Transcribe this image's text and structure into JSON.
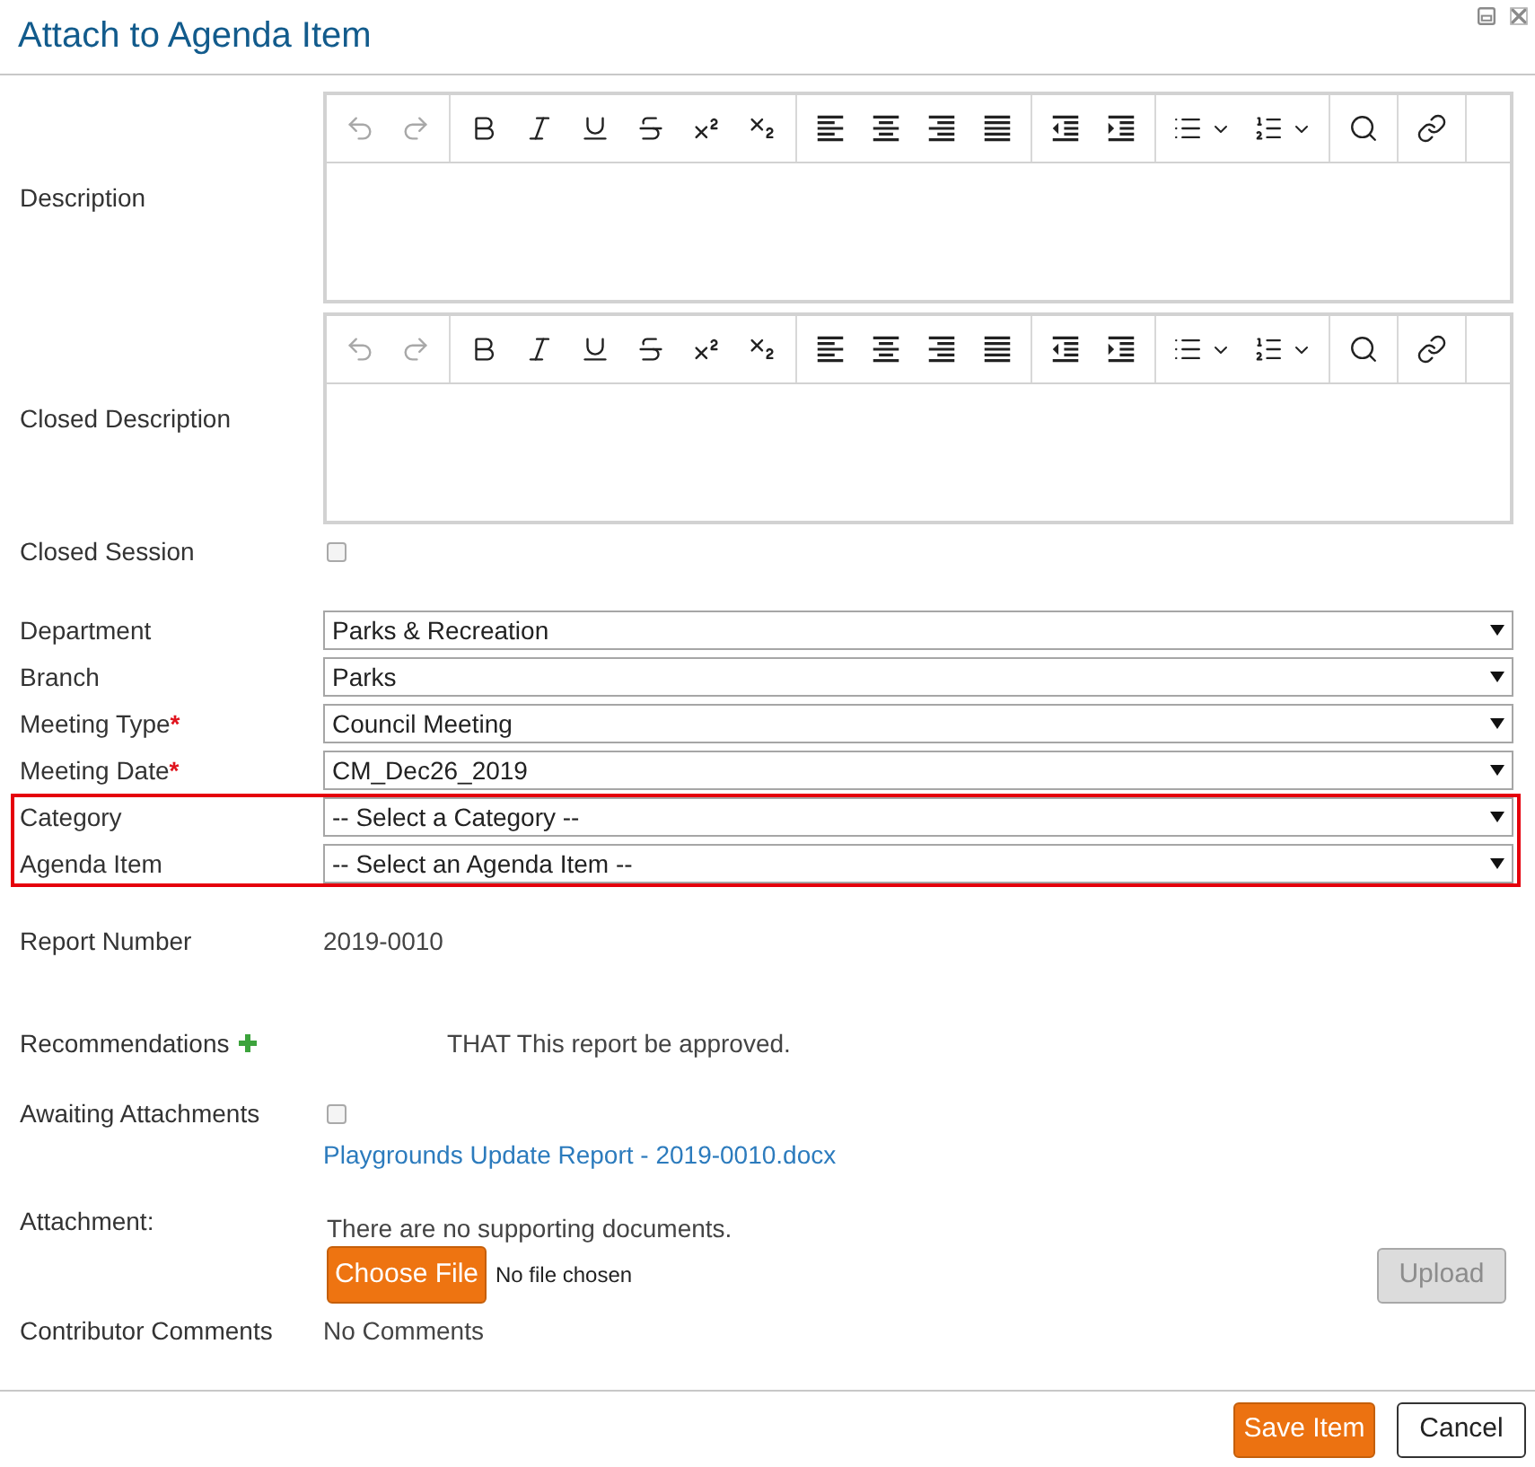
{
  "window": {
    "title": "Attach to Agenda Item"
  },
  "editors": [
    {
      "label": "Description",
      "toolbar": [
        [
          {
            "kind": "undo",
            "disabled": true
          },
          {
            "kind": "redo",
            "disabled": true
          }
        ],
        [
          {
            "kind": "bold",
            "disabled": false
          },
          {
            "kind": "italic",
            "disabled": false
          },
          {
            "kind": "underline",
            "disabled": false
          },
          {
            "kind": "strikethrough",
            "disabled": false
          },
          {
            "kind": "superscript",
            "disabled": false
          },
          {
            "kind": "subscript",
            "disabled": false
          }
        ],
        [
          {
            "kind": "align_left",
            "disabled": false
          },
          {
            "kind": "align_center",
            "disabled": false
          },
          {
            "kind": "align_right",
            "disabled": false
          },
          {
            "kind": "justify",
            "disabled": false
          }
        ],
        [
          {
            "kind": "outdent",
            "disabled": false
          },
          {
            "kind": "indent",
            "disabled": false
          }
        ],
        [
          {
            "kind": "bullet_list",
            "disabled": false
          },
          {
            "kind": "numbered_list",
            "disabled": false
          }
        ],
        [
          {
            "kind": "find",
            "disabled": false
          }
        ],
        [
          {
            "kind": "link",
            "disabled": false
          }
        ]
      ]
    },
    {
      "label": "Closed Description",
      "toolbar": [
        [
          {
            "kind": "undo",
            "disabled": true
          },
          {
            "kind": "redo",
            "disabled": true
          }
        ],
        [
          {
            "kind": "bold",
            "disabled": false
          },
          {
            "kind": "italic",
            "disabled": false
          },
          {
            "kind": "underline",
            "disabled": false
          },
          {
            "kind": "strikethrough",
            "disabled": false
          },
          {
            "kind": "superscript",
            "disabled": false
          },
          {
            "kind": "subscript",
            "disabled": false
          }
        ],
        [
          {
            "kind": "align_left",
            "disabled": false
          },
          {
            "kind": "align_center",
            "disabled": false
          },
          {
            "kind": "align_right",
            "disabled": false
          },
          {
            "kind": "justify",
            "disabled": false
          }
        ],
        [
          {
            "kind": "outdent",
            "disabled": false
          },
          {
            "kind": "indent",
            "disabled": false
          }
        ],
        [
          {
            "kind": "bullet_list",
            "disabled": false
          },
          {
            "kind": "numbered_list",
            "disabled": false
          }
        ],
        [
          {
            "kind": "find",
            "disabled": false
          }
        ],
        [
          {
            "kind": "link",
            "disabled": false
          }
        ]
      ]
    }
  ],
  "closed_session": {
    "label": "Closed Session",
    "checked": false
  },
  "selects": [
    {
      "label": "Department",
      "value": "Parks & Recreation",
      "highlighted": false
    },
    {
      "label": "Branch",
      "value": "Parks",
      "highlighted": false
    },
    {
      "label": "Meeting Type",
      "required_mark": "*",
      "value": "Council Meeting",
      "highlighted": false
    },
    {
      "label": "Meeting Date",
      "required_mark": "*",
      "value": "CM_Dec26_2019",
      "highlighted": false
    },
    {
      "label": "Category",
      "value": "-- Select a Category --",
      "highlighted": true
    },
    {
      "label": "Agenda Item",
      "value": "-- Select an Agenda Item --",
      "highlighted": true
    }
  ],
  "report_number": {
    "label": "Report Number",
    "value": "2019-0010"
  },
  "recommendations": {
    "label": "Recommendations",
    "text": "THAT This report be approved."
  },
  "awaiting_attachments": {
    "label": "Awaiting Attachments",
    "checked": false,
    "link": "Playgrounds Update Report - 2019-0010.docx"
  },
  "attachment": {
    "label": "Attachment:",
    "message": "There are no supporting documents.",
    "choose_button": "Choose File",
    "file_status": "No file chosen",
    "upload_button": {
      "label": "Upload",
      "disabled": true
    }
  },
  "contributor_comments": {
    "label": "Contributor Comments",
    "value": "No Comments"
  },
  "footer_buttons": [
    {
      "label": "Save Item",
      "kind": "primary"
    },
    {
      "label": "Cancel",
      "kind": "secondary"
    }
  ]
}
